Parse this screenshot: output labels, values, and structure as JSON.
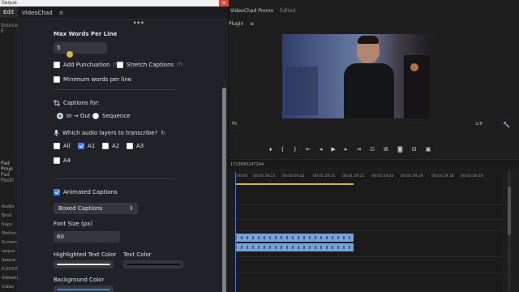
{
  "window": {
    "sequence_tab": "Seque",
    "close_glyph": "✕"
  },
  "premiere_left": {
    "edit_tab": "Edit",
    "source_label": "Source: E",
    "project_label": "Pad Proje",
    "project_label2": "Pad Positi",
    "bins": [
      "Audio",
      "Broll",
      "Kaps",
      "Motion",
      "Screen",
      "seque",
      "Seque",
      "P1(0020",
      "SWeeki",
      "Video"
    ]
  },
  "videochad": {
    "title": "VideoChad",
    "menu_icon": "≡",
    "heading_cut": "...",
    "max_words_label": "Max Words Per Line",
    "max_words_value": "5",
    "add_punctuation_label": "Add Punctuation",
    "add_punctuation_checked": false,
    "stretch_captions_label": "Stretch Captions",
    "stretch_captions_checked": false,
    "info_glyph": "(?)",
    "min_words_label": "Minimum words per line",
    "min_words_checked": false,
    "captions_for_label": "Captions for:",
    "captions_for_options": [
      {
        "label": "In → Out",
        "selected": true
      },
      {
        "label": "Sequence",
        "selected": false
      }
    ],
    "audio_layers_label": "Which audio layers to transcribe?",
    "audio_layers": [
      {
        "label": "All",
        "checked": false
      },
      {
        "label": "A1",
        "checked": true
      },
      {
        "label": "A2",
        "checked": false
      },
      {
        "label": "A3",
        "checked": false
      },
      {
        "label": "A4",
        "checked": false
      }
    ],
    "animated_captions_label": "Animated Captions",
    "animated_captions_checked": true,
    "caption_style_value": "Boxed Captions",
    "font_size_label": "Font Size (px)",
    "font_size_value": "60",
    "highlighted_text_color_label": "Highlighted Text Color",
    "text_color_label": "Text Color",
    "background_color_label": "Background Color",
    "colors": {
      "highlighted": "#e8e8e8",
      "text": "#111111",
      "background": "#4a79c6",
      "accent": "#3b82f6"
    }
  },
  "premiere_right": {
    "program_title": "VideoChad Promo",
    "edited_label": "Edited",
    "plugin_label": "Plugin",
    "fit_label": "Fit",
    "resolution_label": "1/8",
    "timecode": "1713695247244",
    "ruler_times": [
      "00:00",
      "00:00:29:23",
      "00:00:59:22",
      "00:01:29:21",
      "00:01:59:21",
      "00:02:29:20",
      "00:02:59:19",
      "00:03:29:18",
      "00:03:59:18"
    ],
    "transport_icons": [
      "marker-icon",
      "in-point-icon",
      "out-point-icon",
      "go-to-in-icon",
      "step-back-icon",
      "play-icon",
      "step-forward-icon",
      "go-to-out-icon",
      "lift-icon",
      "extract-icon",
      "camera-icon",
      "compare-icon",
      "export-icon"
    ]
  }
}
